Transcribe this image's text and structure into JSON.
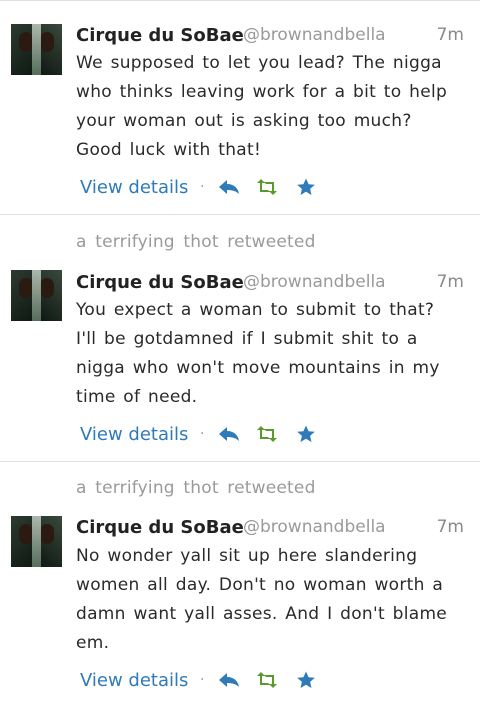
{
  "tweets": [
    {
      "retweeted_by": "",
      "name": "Cirque du SoBae",
      "handle": "@brownandbella",
      "time": "7m",
      "lines": [
        "We supposed to let you lead? The nigga",
        "who thinks leaving work for a bit to help",
        "your woman out is asking too much?",
        "Good luck with that!"
      ],
      "view_details": "View details"
    },
    {
      "retweeted_by": "a terrifying thot retweeted",
      "name": "Cirque du SoBae",
      "handle": "@brownandbella",
      "time": "7m",
      "lines": [
        "You expect a woman to submit to that?",
        "I'll be gotdamned if I submit shit to a",
        "nigga who won't move mountains in my",
        "time of need."
      ],
      "view_details": "View details"
    },
    {
      "retweeted_by": "a terrifying thot retweeted",
      "name": "Cirque du SoBae",
      "handle": "@brownandbella",
      "time": "7m",
      "lines": [
        "No wonder yall sit up here slandering",
        "women all day. Don't no woman worth a",
        "damn want yall asses. And I don't blame",
        "em."
      ],
      "view_details": "View details"
    }
  ],
  "actions": {
    "separator": "·",
    "reply_icon": "reply-arrow-icon",
    "retweet_icon": "retweet-icon",
    "favorite_icon": "star-icon"
  },
  "colors": {
    "link": "#2f7ab8",
    "muted": "#9a9a9a",
    "reply": "#2f7ab8",
    "retweet": "#5a9a2a",
    "favorite": "#2f7ab8"
  }
}
